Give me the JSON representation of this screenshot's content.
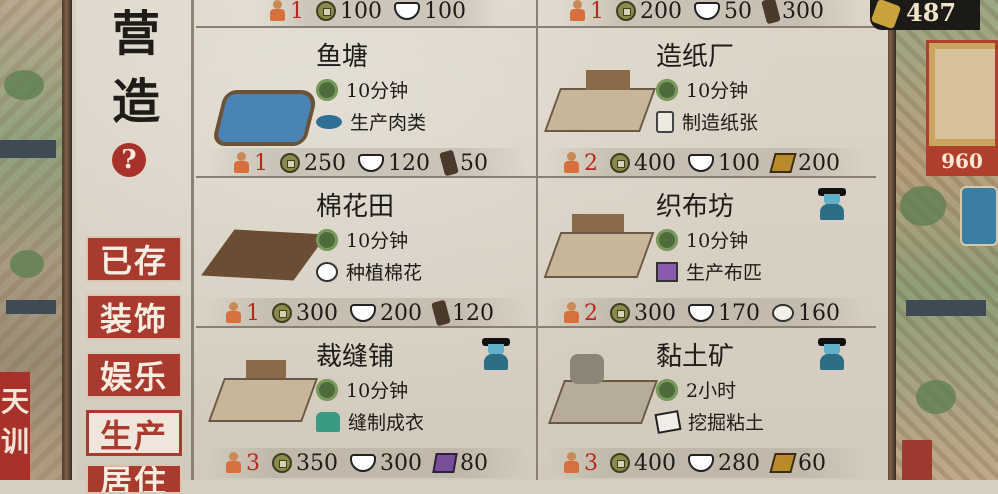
{
  "page": {
    "title_chars": [
      "营",
      "造"
    ],
    "help_label": "?"
  },
  "categories": [
    {
      "label": "已存",
      "active": false
    },
    {
      "label": "装饰",
      "active": false
    },
    {
      "label": "娱乐",
      "active": false
    },
    {
      "label": "生产",
      "active": true
    }
  ],
  "partial_category_label": "居住",
  "left_tab_label": "天训",
  "currency": {
    "amount": "487"
  },
  "right_panel": {
    "price": "960"
  },
  "top_costs": [
    {
      "workers": "1",
      "coins": "100",
      "rice": "100",
      "extra": ""
    },
    {
      "workers": "1",
      "coins": "200",
      "rice": "50",
      "extra": "300"
    }
  ],
  "buildings": [
    {
      "name": "鱼塘",
      "time": "10分钟",
      "output": "生产肉类",
      "output_icon": "fish-icon",
      "workers": "1",
      "coins": "250",
      "rice": "120",
      "extra": "50",
      "extra_icon": "wood-icon",
      "official": false
    },
    {
      "name": "造纸厂",
      "time": "10分钟",
      "output": "制造纸张",
      "output_icon": "paper-scroll-icon",
      "workers": "2",
      "coins": "400",
      "rice": "100",
      "extra": "200",
      "extra_icon": "paper-icon",
      "official": false
    },
    {
      "name": "棉花田",
      "time": "10分钟",
      "output": "种植棉花",
      "output_icon": "cotton-icon",
      "workers": "1",
      "coins": "300",
      "rice": "200",
      "extra": "120",
      "extra_icon": "wood-icon",
      "official": false
    },
    {
      "name": "织布坊",
      "time": "10分钟",
      "output": "生产布匹",
      "output_icon": "cloth-icon",
      "workers": "2",
      "coins": "300",
      "rice": "170",
      "extra": "160",
      "extra_icon": "cotton-icon",
      "official": true
    },
    {
      "name": "裁缝铺",
      "time": "10分钟",
      "output": "缝制成衣",
      "output_icon": "garment-icon",
      "workers": "3",
      "coins": "350",
      "rice": "300",
      "extra": "80",
      "extra_icon": "cloth-icon",
      "official": true
    },
    {
      "name": "黏土矿",
      "time": "2小时",
      "output": "挖掘粘土",
      "output_icon": "clay-icon",
      "workers": "3",
      "coins": "400",
      "rice": "280",
      "extra": "60",
      "extra_icon": "paper-icon",
      "official": true
    }
  ]
}
